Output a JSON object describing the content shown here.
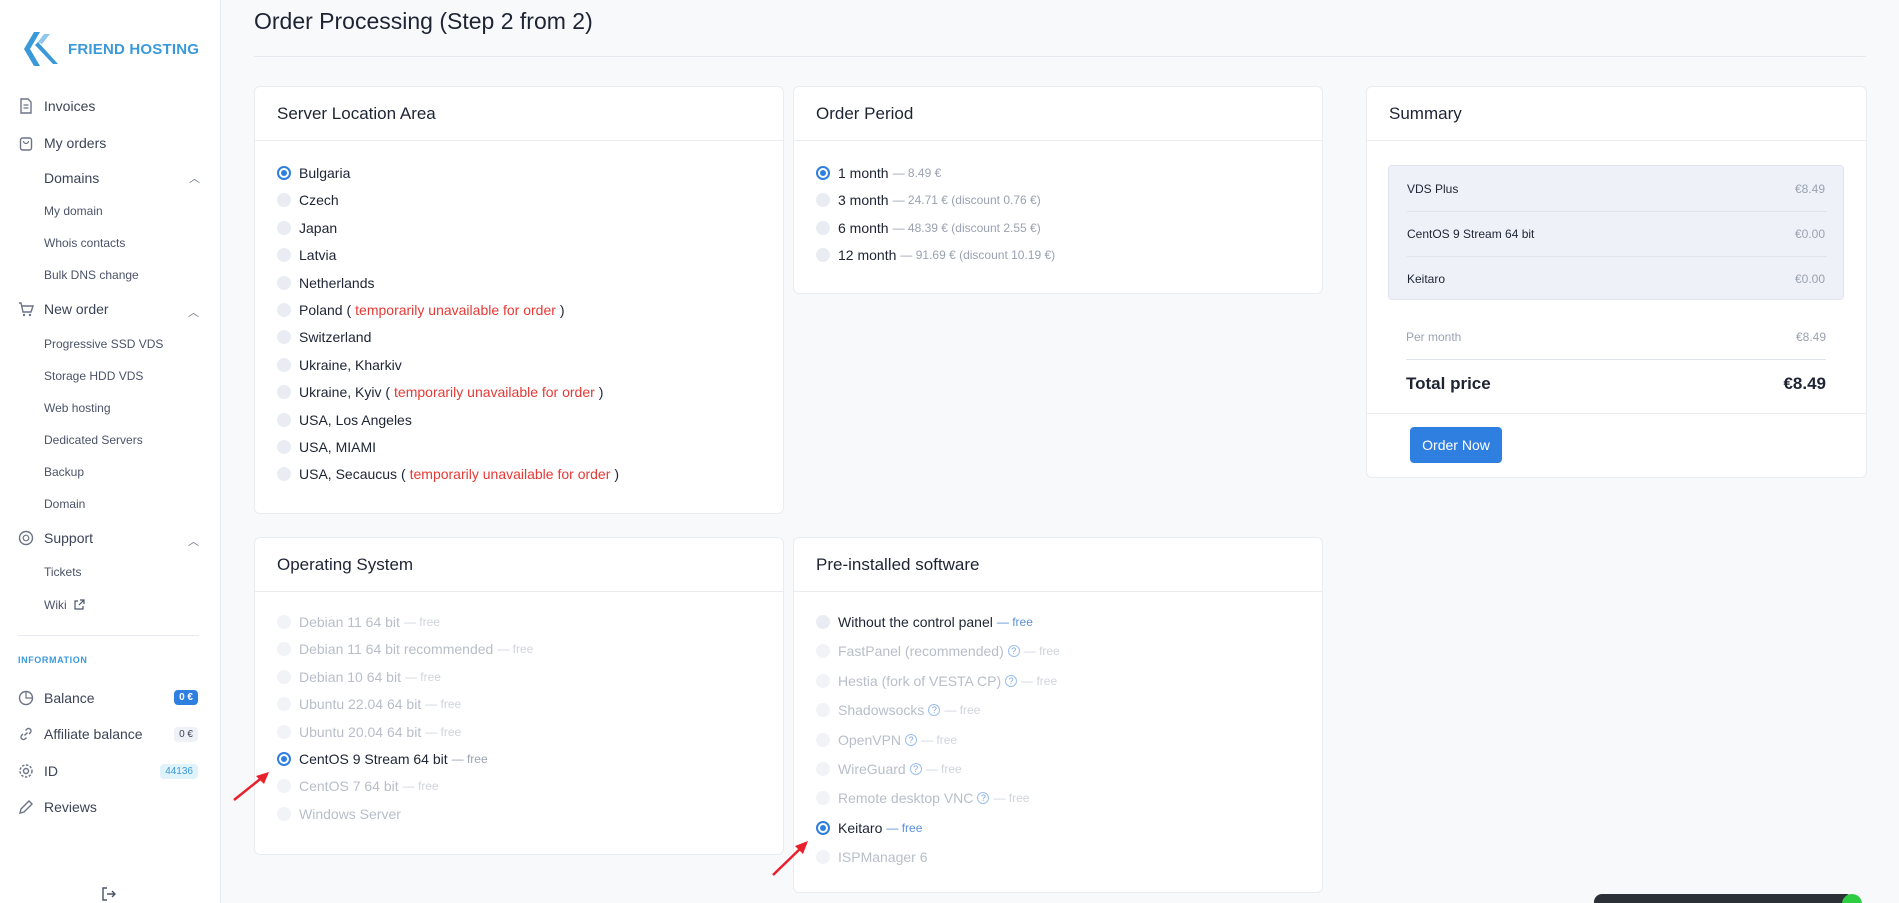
{
  "brand": {
    "name": "FRIEND HOSTING"
  },
  "sidebar": {
    "invoices": "Invoices",
    "my_orders": "My orders",
    "domains": "Domains",
    "my_domain": "My domain",
    "whois": "Whois contacts",
    "bulk_dns": "Bulk DNS change",
    "new_order": "New order",
    "progressive_ssd": "Progressive SSD VDS",
    "storage_hdd": "Storage HDD VDS",
    "web_hosting": "Web hosting",
    "dedicated": "Dedicated Servers",
    "backup": "Backup",
    "domain": "Domain",
    "support": "Support",
    "tickets": "Tickets",
    "wiki": "Wiki",
    "information": "INFORMATION",
    "balance": "Balance",
    "balance_value": "0 €",
    "affiliate": "Affiliate balance",
    "affiliate_value": "0 €",
    "id": "ID",
    "id_value": "44136",
    "reviews": "Reviews"
  },
  "page": {
    "title": "Order Processing (Step 2 from 2)"
  },
  "location": {
    "title": "Server Location Area",
    "unavailable_text": "temporarily unavailable for order",
    "options": [
      {
        "label": "Bulgaria"
      },
      {
        "label": "Czech"
      },
      {
        "label": "Japan"
      },
      {
        "label": "Latvia"
      },
      {
        "label": "Netherlands"
      },
      {
        "label": "Poland (",
        "tail": ")"
      },
      {
        "label": "Switzerland"
      },
      {
        "label": "Ukraine, Kharkiv"
      },
      {
        "label": "Ukraine, Kyiv (",
        "tail": ")"
      },
      {
        "label": "USA, Los Angeles"
      },
      {
        "label": "USA, MIAMI"
      },
      {
        "label": "USA, Secaucus (",
        "tail": ")"
      }
    ],
    "selected": "Bulgaria"
  },
  "period": {
    "title": "Order Period",
    "options": [
      {
        "label": "1 month",
        "note": "— 8.49 €"
      },
      {
        "label": "3 month",
        "note": "— 24.71 € (discount 0.76 €)"
      },
      {
        "label": "6 month",
        "note": "— 48.39 € (discount 2.55 €)"
      },
      {
        "label": "12 month",
        "note": "— 91.69 € (discount 10.19 €)"
      }
    ],
    "selected": "1 month"
  },
  "summary": {
    "title": "Summary",
    "items": [
      {
        "label": "VDS Plus",
        "value": "€8.49"
      },
      {
        "label": "CentOS 9 Stream 64 bit",
        "value": "€0.00"
      },
      {
        "label": "Keitaro",
        "value": "€0.00"
      }
    ],
    "per_month_label": "Per month",
    "per_month_value": "€8.49",
    "total_label": "Total price",
    "total_value": "€8.49",
    "order_button": "Order Now"
  },
  "os": {
    "title": "Operating System",
    "options": [
      {
        "label": "Debian 11 64 bit",
        "note": "— free"
      },
      {
        "label": "Debian 11 64 bit recommended",
        "note": "— free"
      },
      {
        "label": "Debian 10 64 bit",
        "note": "— free"
      },
      {
        "label": "Ubuntu 22.04 64 bit",
        "note": "— free"
      },
      {
        "label": "Ubuntu 20.04 64 bit",
        "note": "— free"
      },
      {
        "label": "CentOS 9 Stream 64 bit",
        "note": "— free"
      },
      {
        "label": "CentOS 7 64 bit",
        "note": "— free"
      },
      {
        "label": "Windows Server",
        "note": ""
      }
    ],
    "selected": "CentOS 9 Stream 64 bit"
  },
  "software": {
    "title": "Pre-installed software",
    "options": [
      {
        "label": "Without the control panel",
        "note": "— free"
      },
      {
        "label": "FastPanel (recommended)",
        "note": "— free"
      },
      {
        "label": "Hestia (fork of VESTA CP)",
        "note": "— free"
      },
      {
        "label": "Shadowsocks",
        "note": "— free"
      },
      {
        "label": "OpenVPN",
        "note": "— free"
      },
      {
        "label": "WireGuard",
        "note": "— free"
      },
      {
        "label": "Remote desktop VNC",
        "note": "— free"
      },
      {
        "label": "Keitaro",
        "note": "— free"
      },
      {
        "label": "ISPManager 6",
        "note": ""
      }
    ],
    "selected": "Keitaro"
  },
  "colors": {
    "accent": "#2f7fe0",
    "brand": "#3a9ad9",
    "danger": "#e53935"
  }
}
